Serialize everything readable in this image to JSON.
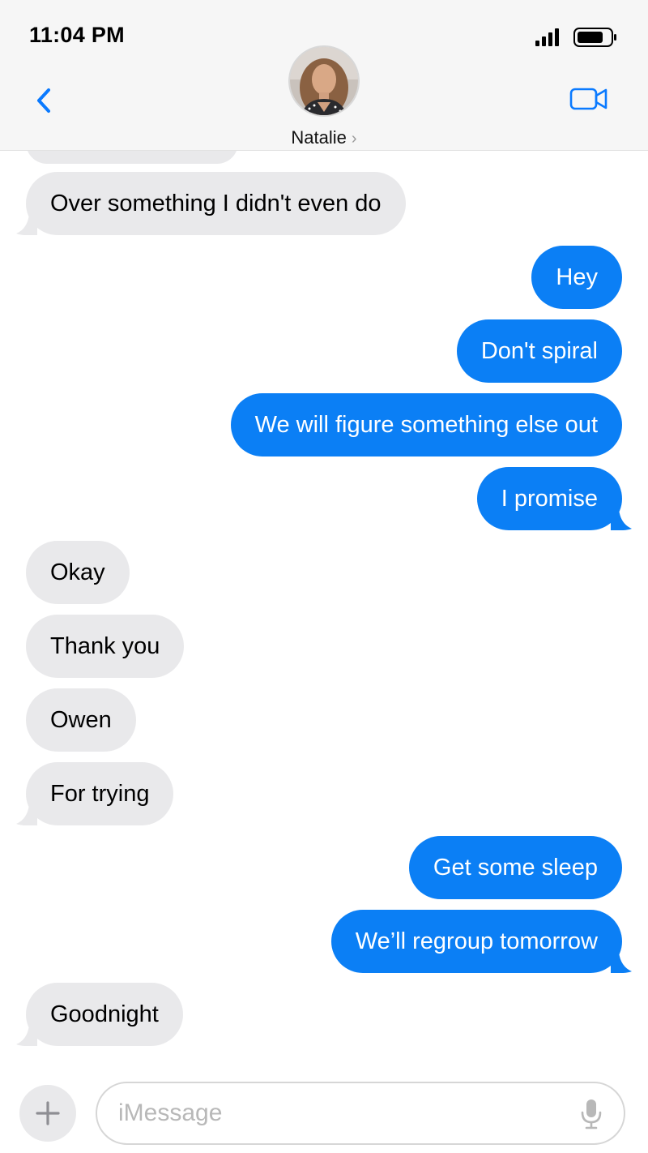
{
  "status": {
    "time": "11:04 PM"
  },
  "header": {
    "contact_name": "Natalie",
    "chevron": "›"
  },
  "messages": [
    {
      "side": "in",
      "text": "Over something I didn't even do"
    },
    {
      "side": "out",
      "text": "Hey"
    },
    {
      "side": "out",
      "text": "Don't spiral"
    },
    {
      "side": "out",
      "text": "We will figure something else out"
    },
    {
      "side": "out",
      "text": "I promise"
    },
    {
      "side": "in",
      "text": "Okay"
    },
    {
      "side": "in",
      "text": "Thank you"
    },
    {
      "side": "in",
      "text": "Owen"
    },
    {
      "side": "in",
      "text": "For trying"
    },
    {
      "side": "out",
      "text": "Get some sleep"
    },
    {
      "side": "out",
      "text": "We’ll regroup tomorrow"
    },
    {
      "side": "in",
      "text": "Goodnight"
    }
  ],
  "composer": {
    "placeholder": "iMessage"
  },
  "icons": {
    "back": "chevron-left-icon",
    "video": "video-camera-icon",
    "signal": "signal-bars-icon",
    "battery": "battery-icon",
    "add": "plus-icon",
    "mic": "microphone-icon"
  },
  "colors": {
    "outgoing": "#0b7ff5",
    "incoming": "#e9e9eb",
    "accent": "#0a7aff"
  }
}
